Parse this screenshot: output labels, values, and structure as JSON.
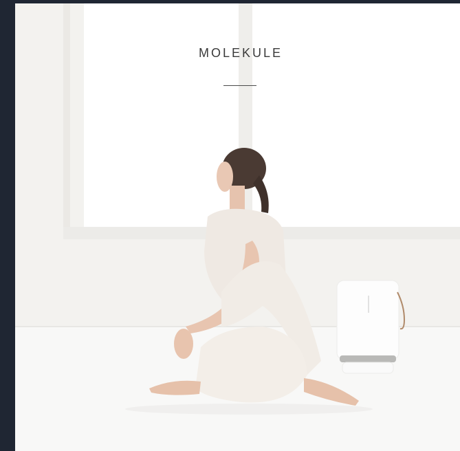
{
  "brand": {
    "name": "MOLEKULE"
  },
  "colors": {
    "frame": "#1f2633",
    "background": "#f5f4f2",
    "text": "#3a3a3a"
  }
}
